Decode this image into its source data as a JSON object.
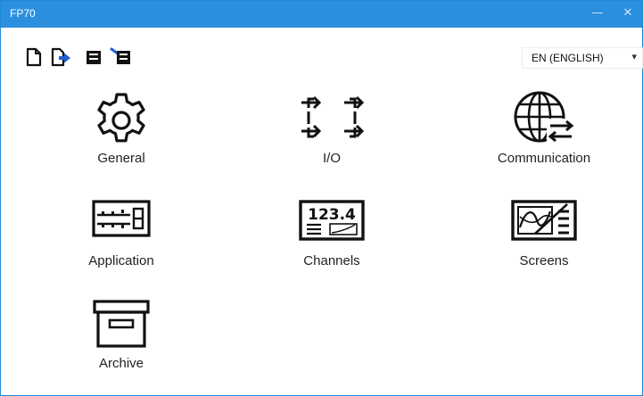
{
  "window": {
    "title": "FP70",
    "minimize_glyph": "—",
    "close_glyph": "✕"
  },
  "toolbar": {
    "buttons": [
      {
        "name": "new-document-icon"
      },
      {
        "name": "open-document-icon"
      },
      {
        "name": "save-icon"
      },
      {
        "name": "save-to-device-icon"
      }
    ],
    "language": {
      "selected": "EN (ENGLISH)",
      "arrow": "▾"
    }
  },
  "menu": {
    "items": [
      {
        "label": "General",
        "icon": "gear-icon"
      },
      {
        "label": "I/O",
        "icon": "io-arrows-icon"
      },
      {
        "label": "Communication",
        "icon": "globe-exchange-icon"
      },
      {
        "label": "Application",
        "icon": "application-panel-icon"
      },
      {
        "label": "Channels",
        "icon": "channels-display-icon"
      },
      {
        "label": "Screens",
        "icon": "screens-chart-icon"
      },
      {
        "label": "Archive",
        "icon": "archive-box-icon"
      }
    ]
  },
  "colors": {
    "titlebar": "#2b8fe0",
    "border": "#1e8bd6",
    "icon": "#111111"
  }
}
